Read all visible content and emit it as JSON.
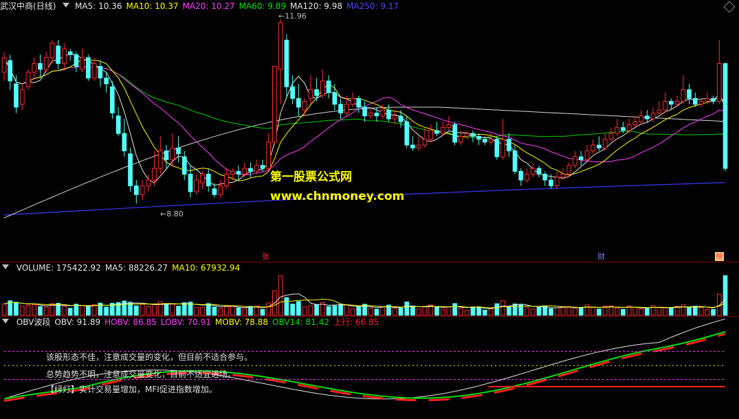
{
  "window": {
    "stock": "武汉中商",
    "period": "(日线)"
  },
  "price_legend": [
    {
      "label": "MA5: 10.36",
      "color": "#e8e8e8"
    },
    {
      "label": "MA10: 10.37",
      "color": "#ffff00"
    },
    {
      "label": "MA20: 10.27",
      "color": "#ff40ff"
    },
    {
      "label": "MA60: 9.89",
      "color": "#00e000"
    },
    {
      "label": "MA120: 9.98",
      "color": "#e8e8e8"
    },
    {
      "label": "MA250: 9.17",
      "color": "#4a4aff"
    }
  ],
  "volume_legend": [
    {
      "label": "VOLUME: 175422.92",
      "color": "#e8e8e8"
    },
    {
      "label": "MA5: 88226.27",
      "color": "#e8e8e8"
    },
    {
      "label": "MA10: 67932.94",
      "color": "#ffff00"
    }
  ],
  "obv_legend": [
    {
      "label": "OBV波段",
      "color": "#e8e8e8"
    },
    {
      "label": "OBV: 91.89",
      "color": "#e8e8e8"
    },
    {
      "label": "HOBV: 86.85",
      "color": "#ff40ff"
    },
    {
      "label": "LOBV: 70.91",
      "color": "#ff40ff"
    },
    {
      "label": "MOBV: 78.88",
      "color": "#ffff00"
    },
    {
      "label": "OBV14: 81.42",
      "color": "#00e000"
    },
    {
      "label": "上行: 66.85",
      "color": "#ff2020"
    }
  ],
  "annotations": {
    "high": "11.96",
    "low": "8.80"
  },
  "markers": [
    {
      "text": "张",
      "color": "#ff3030",
      "bg": "#000"
    },
    {
      "text": "财",
      "color": "#8080ff",
      "bg": "#000"
    },
    {
      "text": "榜",
      "color": "#ff3030",
      "bg": "#ffd080"
    }
  ],
  "watermark": {
    "line1": "第一股票公式网",
    "line2": "www.chnmoney.com"
  },
  "notes": [
    "该股形态不佳，注意成交量的变化，但目前不适合参与。",
    "总势趋势不明，注意成交量变化，目前不适宜进场。",
    "【绿灯】实计交易量增加，MFI促进指数增加。"
  ],
  "chart_data": {
    "type": "candlestick",
    "candles": [
      [
        11.05,
        11.3,
        10.9,
        11.4
      ],
      [
        11.25,
        10.9,
        10.75,
        11.35
      ],
      [
        10.85,
        10.45,
        10.35,
        11.0
      ],
      [
        10.5,
        10.75,
        10.4,
        10.85
      ],
      [
        10.8,
        11.05,
        10.75,
        11.1
      ],
      [
        11.05,
        11.2,
        10.95,
        11.3
      ],
      [
        11.2,
        11.1,
        10.95,
        11.35
      ],
      [
        11.1,
        11.3,
        11.05,
        11.4
      ],
      [
        11.3,
        11.55,
        11.2,
        11.6
      ],
      [
        11.5,
        11.2,
        11.1,
        11.6
      ],
      [
        11.2,
        11.45,
        11.1,
        11.55
      ],
      [
        11.4,
        11.35,
        11.25,
        11.45
      ],
      [
        11.35,
        11.15,
        11.05,
        11.4
      ],
      [
        11.1,
        11.3,
        11.05,
        11.45
      ],
      [
        11.3,
        10.95,
        10.9,
        11.35
      ],
      [
        10.95,
        11.2,
        10.9,
        11.3
      ],
      [
        11.15,
        10.95,
        10.8,
        11.25
      ],
      [
        10.95,
        10.85,
        10.7,
        11.05
      ],
      [
        10.8,
        10.35,
        10.25,
        10.9
      ],
      [
        10.3,
        10.0,
        9.95,
        10.45
      ],
      [
        10.0,
        9.7,
        9.6,
        10.25
      ],
      [
        9.65,
        9.1,
        9.0,
        9.75
      ],
      [
        9.1,
        8.95,
        8.8,
        9.2
      ],
      [
        8.95,
        9.1,
        8.85,
        9.2
      ],
      [
        9.1,
        9.2,
        9.0,
        9.3
      ],
      [
        9.2,
        9.4,
        9.1,
        9.7
      ],
      [
        9.4,
        9.7,
        9.3,
        9.95
      ],
      [
        9.7,
        9.55,
        9.4,
        9.8
      ],
      [
        9.55,
        9.75,
        9.45,
        10.0
      ],
      [
        9.75,
        9.65,
        9.5,
        9.95
      ],
      [
        9.6,
        9.3,
        9.2,
        9.7
      ],
      [
        9.3,
        9.0,
        8.9,
        9.45
      ],
      [
        9.0,
        9.2,
        8.95,
        9.3
      ],
      [
        9.15,
        9.3,
        9.05,
        9.35
      ],
      [
        9.3,
        9.1,
        9.0,
        9.4
      ],
      [
        9.05,
        8.95,
        8.9,
        9.15
      ],
      [
        8.95,
        9.1,
        8.9,
        9.2
      ],
      [
        9.1,
        9.3,
        9.05,
        9.4
      ],
      [
        9.3,
        9.35,
        9.2,
        9.4
      ],
      [
        9.35,
        9.3,
        9.2,
        9.45
      ],
      [
        9.3,
        9.4,
        9.25,
        9.5
      ],
      [
        9.4,
        9.35,
        9.25,
        9.5
      ],
      [
        9.35,
        9.45,
        9.3,
        9.55
      ],
      [
        9.45,
        9.4,
        9.35,
        9.55
      ],
      [
        9.4,
        9.85,
        9.35,
        10.0
      ],
      [
        9.85,
        11.15,
        9.8,
        11.15
      ],
      [
        11.1,
        11.9,
        10.5,
        11.96
      ],
      [
        11.6,
        10.8,
        10.6,
        11.7
      ],
      [
        10.8,
        10.6,
        10.5,
        11.0
      ],
      [
        10.6,
        10.45,
        10.3,
        10.85
      ],
      [
        10.4,
        10.55,
        10.3,
        10.6
      ],
      [
        10.6,
        10.75,
        10.5,
        11.0
      ],
      [
        10.75,
        10.65,
        10.55,
        10.95
      ],
      [
        10.65,
        10.9,
        10.6,
        11.1
      ],
      [
        10.9,
        10.7,
        10.6,
        11.0
      ],
      [
        10.7,
        10.5,
        10.4,
        10.85
      ],
      [
        10.5,
        10.35,
        10.25,
        10.6
      ],
      [
        10.35,
        10.5,
        10.3,
        10.65
      ],
      [
        10.5,
        10.6,
        10.45,
        10.7
      ],
      [
        10.6,
        10.45,
        10.35,
        10.65
      ],
      [
        10.45,
        10.3,
        10.2,
        10.55
      ],
      [
        10.3,
        10.35,
        10.25,
        10.45
      ],
      [
        10.35,
        10.3,
        10.2,
        10.45
      ],
      [
        10.3,
        10.4,
        10.25,
        10.5
      ],
      [
        10.4,
        10.25,
        10.2,
        10.5
      ],
      [
        10.25,
        10.3,
        10.15,
        10.4
      ],
      [
        10.3,
        10.2,
        10.1,
        10.4
      ],
      [
        10.2,
        9.8,
        9.75,
        10.3
      ],
      [
        9.8,
        9.75,
        9.7,
        9.95
      ],
      [
        9.75,
        9.8,
        9.7,
        9.95
      ],
      [
        9.8,
        9.9,
        9.75,
        10.1
      ],
      [
        9.9,
        10.05,
        9.85,
        10.15
      ],
      [
        10.05,
        10.0,
        9.95,
        10.2
      ],
      [
        10.0,
        10.1,
        9.95,
        10.2
      ],
      [
        10.1,
        10.15,
        10.05,
        10.3
      ],
      [
        10.15,
        9.85,
        9.8,
        10.2
      ],
      [
        9.85,
        9.95,
        9.8,
        10.05
      ],
      [
        9.95,
        10.0,
        9.9,
        10.05
      ],
      [
        10.0,
        9.95,
        9.85,
        10.05
      ],
      [
        9.95,
        9.9,
        9.8,
        10.0
      ],
      [
        9.9,
        9.85,
        9.8,
        9.95
      ],
      [
        9.85,
        9.9,
        9.8,
        10.0
      ],
      [
        9.9,
        9.6,
        9.55,
        9.95
      ],
      [
        9.6,
        9.9,
        9.55,
        10.25
      ],
      [
        9.9,
        9.7,
        9.6,
        10.0
      ],
      [
        9.7,
        9.35,
        9.3,
        9.8
      ],
      [
        9.35,
        9.2,
        9.1,
        9.4
      ],
      [
        9.2,
        9.3,
        9.15,
        9.4
      ],
      [
        9.3,
        9.4,
        9.25,
        9.5
      ],
      [
        9.4,
        9.3,
        9.25,
        9.45
      ],
      [
        9.3,
        9.2,
        9.1,
        9.35
      ],
      [
        9.2,
        9.1,
        9.05,
        9.3
      ],
      [
        9.1,
        9.25,
        9.05,
        9.35
      ],
      [
        9.25,
        9.3,
        9.2,
        9.4
      ],
      [
        9.3,
        9.45,
        9.25,
        9.5
      ],
      [
        9.45,
        9.6,
        9.4,
        9.7
      ],
      [
        9.6,
        9.55,
        9.45,
        9.7
      ],
      [
        9.55,
        9.7,
        9.5,
        9.8
      ],
      [
        9.7,
        9.8,
        9.65,
        9.9
      ],
      [
        9.8,
        9.75,
        9.7,
        9.95
      ],
      [
        9.75,
        9.9,
        9.7,
        10.0
      ],
      [
        9.9,
        10.0,
        9.85,
        10.1
      ],
      [
        10.0,
        10.1,
        9.95,
        10.25
      ],
      [
        10.1,
        10.05,
        10.0,
        10.2
      ],
      [
        10.05,
        10.15,
        10.0,
        10.25
      ],
      [
        10.15,
        10.2,
        10.1,
        10.3
      ],
      [
        10.2,
        10.3,
        10.15,
        10.4
      ],
      [
        10.3,
        10.25,
        10.2,
        10.4
      ],
      [
        10.25,
        10.35,
        10.2,
        10.45
      ],
      [
        10.35,
        10.4,
        10.3,
        10.55
      ],
      [
        10.4,
        10.55,
        10.35,
        10.7
      ],
      [
        10.55,
        10.5,
        10.4,
        10.6
      ],
      [
        10.5,
        10.55,
        10.45,
        10.65
      ],
      [
        10.55,
        10.75,
        10.5,
        11.0
      ],
      [
        10.75,
        10.6,
        10.5,
        10.85
      ],
      [
        10.6,
        10.5,
        10.45,
        10.7
      ],
      [
        10.5,
        10.55,
        10.45,
        10.6
      ],
      [
        10.55,
        10.6,
        10.5,
        10.7
      ],
      [
        10.6,
        10.55,
        10.5,
        10.65
      ],
      [
        10.55,
        11.2,
        10.5,
        11.6
      ],
      [
        11.2,
        9.4,
        9.35,
        11.2
      ]
    ],
    "ma5_last": 10.36,
    "ma10_last": 10.37,
    "ma20_last": 10.27,
    "ma60_last": 9.89,
    "ma120_last": 9.98,
    "ma250_last": 9.17,
    "price_range": [
      8.4,
      12.1
    ],
    "volume_last": 175422.92,
    "volume_ma5": 88226.27,
    "volume_ma10": 67932.94,
    "obv": 91.89,
    "hobv": 86.85,
    "lobv": 70.91,
    "mobv": 78.88,
    "obv14": 81.42,
    "upline": 66.85
  }
}
